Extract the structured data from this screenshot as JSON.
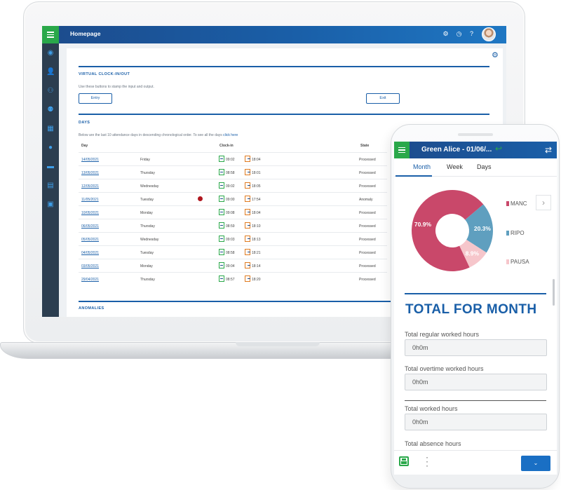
{
  "laptop": {
    "app_title": "Homepage",
    "header_icons": [
      "gear-icon",
      "clock-icon",
      "help-icon"
    ],
    "sidebar_icons": [
      "dashboard-icon",
      "user-icon",
      "team-icon",
      "user-settings-icon",
      "calendar-icon",
      "globe-icon",
      "card-icon",
      "report-icon",
      "schedule-icon"
    ],
    "clock_section": {
      "title": "VIRTUAL CLOCK-IN/OUT",
      "description": "Use these buttons to stamp the input and output.",
      "entry_label": "Entry",
      "exit_label": "Exit"
    },
    "days_section": {
      "title": "DAYS",
      "description": "Below are the last 10 attendance days in descending chronological order. To see all the days",
      "link_text": "click here",
      "columns": {
        "day": "Day",
        "clock_in": "Clock-in",
        "state": "State"
      },
      "rows": [
        {
          "date": "14/05/2021",
          "weekday": "Friday",
          "in": "09:02",
          "out": "18:04",
          "state": "Processed",
          "flag": false
        },
        {
          "date": "13/05/2021",
          "weekday": "Thursday",
          "in": "08:58",
          "out": "18:01",
          "state": "Processed",
          "flag": false
        },
        {
          "date": "12/05/2021",
          "weekday": "Wednesday",
          "in": "09:02",
          "out": "18:05",
          "state": "Processed",
          "flag": false
        },
        {
          "date": "11/05/2021",
          "weekday": "Tuesday",
          "in": "09:00",
          "out": "17:54",
          "state": "Anomaly",
          "flag": true
        },
        {
          "date": "10/05/2021",
          "weekday": "Monday",
          "in": "09:08",
          "out": "18:04",
          "state": "Processed",
          "flag": false
        },
        {
          "date": "06/05/2021",
          "weekday": "Thursday",
          "in": "08:59",
          "out": "18:10",
          "state": "Processed",
          "flag": false
        },
        {
          "date": "05/05/2021",
          "weekday": "Wednesday",
          "in": "09:03",
          "out": "18:13",
          "state": "Processed",
          "flag": false
        },
        {
          "date": "04/05/2021",
          "weekday": "Tuesday",
          "in": "08:58",
          "out": "18:21",
          "state": "Processed",
          "flag": false
        },
        {
          "date": "03/05/2021",
          "weekday": "Monday",
          "in": "09:04",
          "out": "18:14",
          "state": "Processed",
          "flag": false
        },
        {
          "date": "29/04/2021",
          "weekday": "Thursday",
          "in": "08:57",
          "out": "18:20",
          "state": "Processed",
          "flag": false
        }
      ]
    },
    "anomalies_section": {
      "title": "ANOMALIES"
    }
  },
  "phone": {
    "title": "Green Alice - 01/06/...",
    "tabs": [
      "Month",
      "Week",
      "Days"
    ],
    "active_tab": "Month",
    "total_title": "TOTAL FOR MONTH",
    "fields": [
      {
        "label": "Total regular worked hours",
        "value": "0h0m"
      },
      {
        "label": "Total overtime worked hours",
        "value": "0h0m"
      },
      {
        "label": "Total worked hours",
        "value": "0h0m"
      },
      {
        "label": "Total absence hours",
        "value": ""
      }
    ],
    "dropdown_icon": "chevron-down-icon"
  },
  "chart_data": {
    "type": "pie",
    "donut": true,
    "categories": [
      "MANC",
      "RIPO",
      "PAUSA"
    ],
    "values": [
      70.9,
      20.3,
      8.9
    ],
    "labels": [
      "70.9%",
      "20.3%",
      "8.9%"
    ],
    "colors": [
      "#c9486a",
      "#5f9fbf",
      "#f6c6cb"
    ],
    "legend_position": "right"
  },
  "colors": {
    "brand_blue": "#1a5fa8",
    "accent_green": "#2aa84a",
    "anomaly_red": "#b0171f"
  }
}
